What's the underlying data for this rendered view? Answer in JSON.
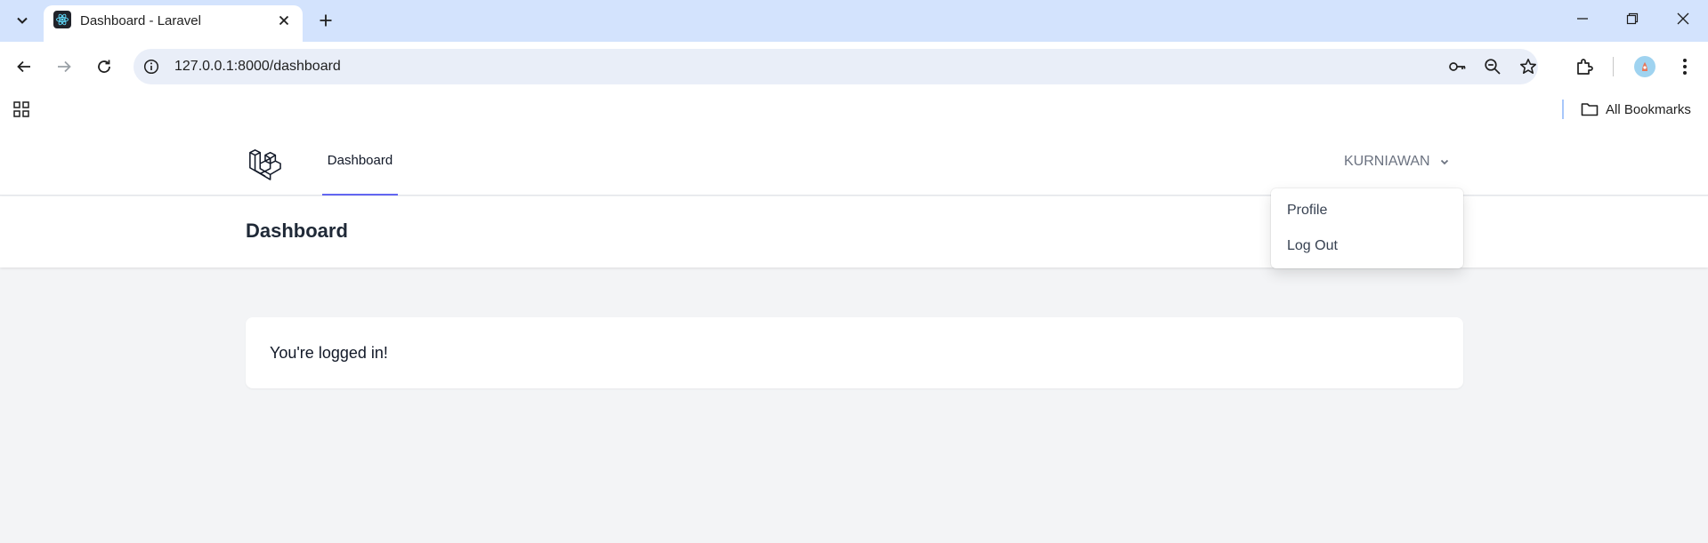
{
  "browser": {
    "tab_title": "Dashboard - Laravel",
    "url": "127.0.0.1:8000/dashboard",
    "bookmarks_label": "All Bookmarks"
  },
  "app": {
    "nav_dashboard": "Dashboard",
    "user_name": "KURNIAWAN",
    "page_title": "Dashboard",
    "message": "You're logged in!",
    "menu": [
      "Profile",
      "Log Out"
    ],
    "accent_color": "#6366f1"
  }
}
